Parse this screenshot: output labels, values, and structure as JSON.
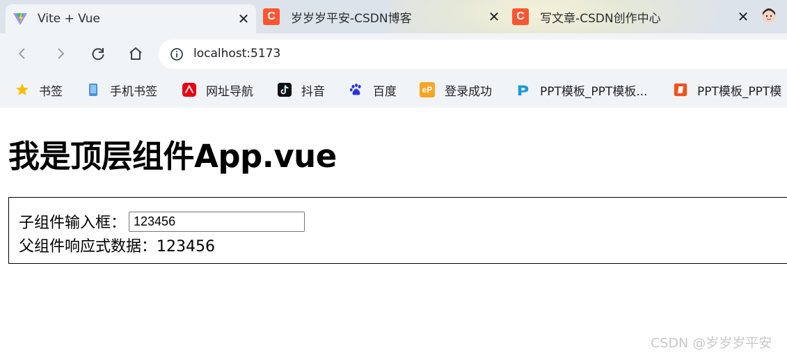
{
  "browser": {
    "tabs": [
      {
        "title": "Vite + Vue",
        "icon": "vite-logo-icon",
        "active": true
      },
      {
        "title": "岁岁岁平安-CSDN博客",
        "icon": "csdn-logo-icon",
        "active": false
      },
      {
        "title": "写文章-CSDN创作中心",
        "icon": "csdn-logo-icon",
        "active": false
      }
    ],
    "close_glyph": "✕",
    "csdn_letter": "C",
    "address": "localhost:5173",
    "bookmarks": [
      {
        "label": "书签",
        "icon": "star-icon"
      },
      {
        "label": "手机书签",
        "icon": "phone-icon"
      },
      {
        "label": "网址导航",
        "icon": "hao123-icon"
      },
      {
        "label": "抖音",
        "icon": "douyin-icon"
      },
      {
        "label": "百度",
        "icon": "baidu-icon"
      },
      {
        "label": "登录成功",
        "icon": "ep-icon"
      },
      {
        "label": "PPT模板_PPT模板...",
        "icon": "ppt-blue-icon"
      },
      {
        "label": "PPT模板_PPT模",
        "icon": "ppt-orange-icon"
      }
    ],
    "ep_text": "eP"
  },
  "page": {
    "title": "我是顶层组件App.vue",
    "child_label": "子组件输入框：",
    "child_input_value": "123456",
    "parent_label": "父组件响应式数据：",
    "parent_value": "123456"
  },
  "watermark": "CSDN @岁岁岁平安",
  "colors": {
    "csdn_red": "#fc5531",
    "chrome_bg": "#f1f4f7",
    "tabstrip_bg": "#dde3ea"
  }
}
